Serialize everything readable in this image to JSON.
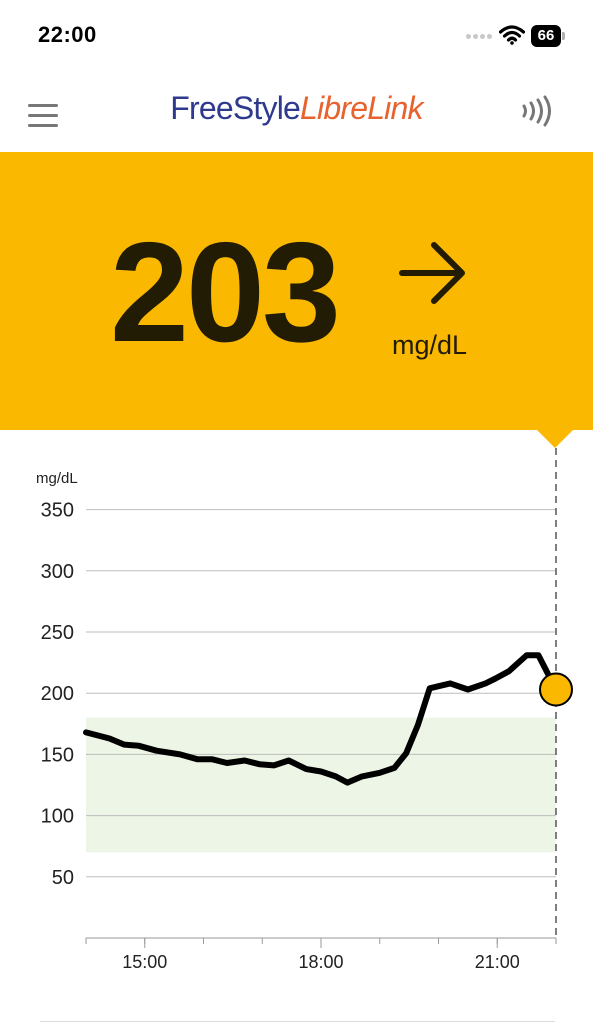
{
  "status_bar": {
    "time": "22:00",
    "battery": "66"
  },
  "header": {
    "logo_part1": "FreeStyle",
    "logo_part2": "LibreLink",
    "menu_icon": "hamburger-menu-icon",
    "scan_icon": "nfc-scan-icon"
  },
  "reading": {
    "value": "203",
    "unit": "mg/dL",
    "trend": "steady-right-arrow",
    "panel_color": "#fbb800"
  },
  "chart_data": {
    "type": "line",
    "ylabel": "mg/dL",
    "ylim": [
      0,
      350
    ],
    "yticks": [
      50,
      100,
      150,
      200,
      250,
      300,
      350
    ],
    "xlim": [
      14.0,
      22.0
    ],
    "xticks": [
      15,
      18,
      21
    ],
    "xticklabels": [
      "15:00",
      "18:00",
      "21:00"
    ],
    "target_range": [
      70,
      180
    ],
    "target_color": "#edf6e6",
    "line_color": "#000000",
    "current_point": {
      "x": 22.0,
      "y": 203,
      "color": "#fbb800"
    },
    "series": [
      {
        "x": [
          14.0,
          14.4,
          14.65,
          14.9,
          15.2,
          15.6,
          15.9,
          16.15,
          16.4,
          16.7,
          16.95,
          17.2,
          17.45,
          17.75,
          18.0,
          18.25,
          18.45,
          18.7,
          19.0,
          19.25,
          19.45,
          19.65,
          19.85,
          20.2,
          20.5,
          20.8,
          20.97,
          21.2,
          21.5,
          21.7,
          22.0
        ],
        "y": [
          168,
          163,
          158,
          157,
          153,
          150,
          146,
          146,
          143,
          145,
          142,
          141,
          145,
          138,
          136,
          132,
          127,
          132,
          135,
          139,
          151,
          174,
          204,
          208,
          203,
          208,
          212,
          218,
          231,
          231,
          203
        ]
      }
    ]
  }
}
